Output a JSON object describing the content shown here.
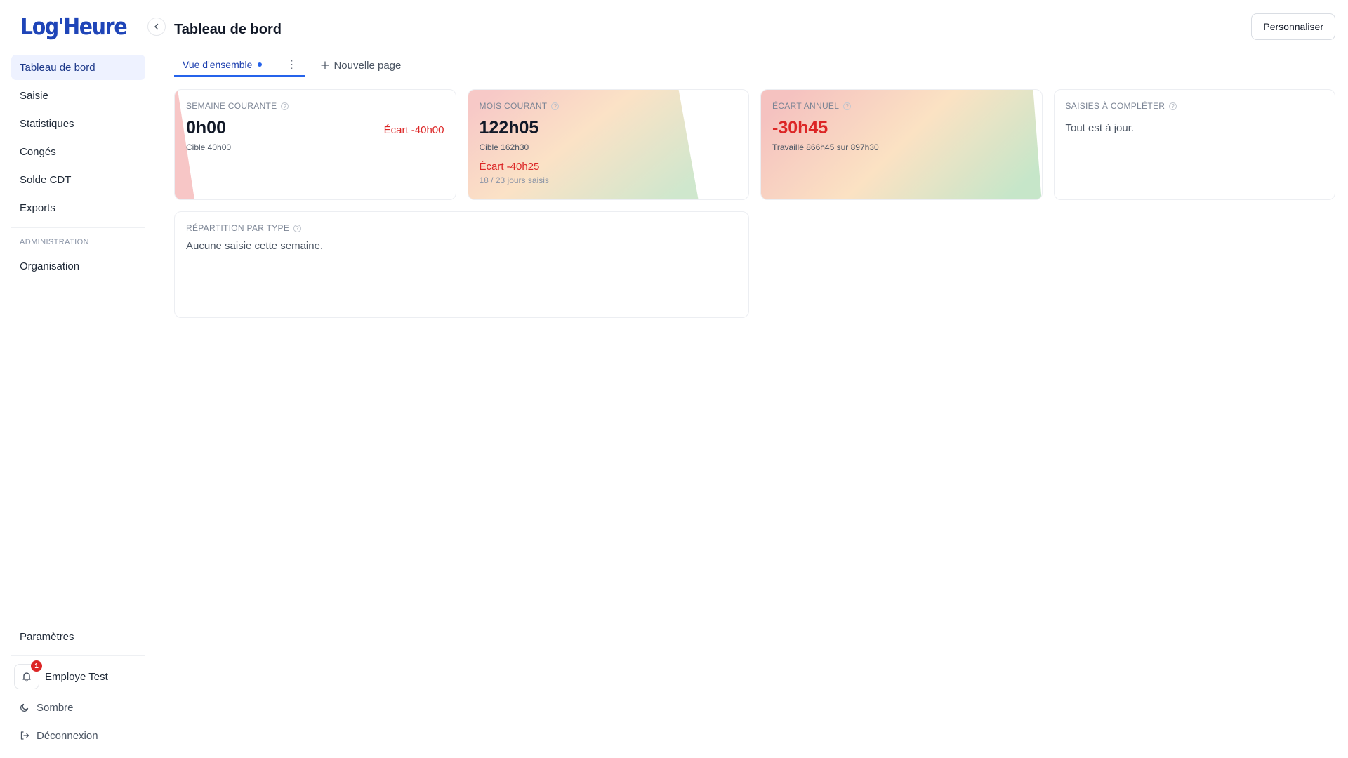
{
  "app": {
    "brand": "Log'Heure"
  },
  "sidebar": {
    "items": [
      {
        "label": "Tableau de bord"
      },
      {
        "label": "Saisie"
      },
      {
        "label": "Statistiques"
      },
      {
        "label": "Congés"
      },
      {
        "label": "Solde CDT"
      },
      {
        "label": "Exports"
      }
    ],
    "section_admin": "ADMINISTRATION",
    "admin_items": [
      {
        "label": "Organisation"
      }
    ],
    "settings_label": "Paramètres",
    "user_name": "Employe Test",
    "notification_count": "1",
    "theme_label": "Sombre",
    "logout_label": "Déconnexion"
  },
  "header": {
    "title": "Tableau de bord",
    "customize_label": "Personnaliser"
  },
  "tabs": {
    "active_label": "Vue d'ensemble",
    "new_page_label": "Nouvelle page"
  },
  "cards": {
    "week": {
      "label": "SEMAINE COURANTE",
      "value": "0h00",
      "ecart": "Écart -40h00",
      "target": "Cible 40h00"
    },
    "month": {
      "label": "MOIS COURANT",
      "value": "122h05",
      "target": "Cible 162h30",
      "ecart": "Écart -40h25",
      "days": "18 / 23 jours saisis"
    },
    "annual": {
      "label": "ÉCART ANNUEL",
      "value": "-30h45",
      "detail": "Travaillé 866h45 sur 897h30"
    },
    "pending": {
      "label": "SAISIES À COMPLÉTER",
      "text": "Tout est à jour."
    },
    "breakdown": {
      "label": "RÉPARTITION PAR TYPE",
      "text": "Aucune saisie cette semaine."
    }
  },
  "colors": {
    "accent": "#2563eb",
    "brand": "#1f45b8",
    "danger": "#dc2626"
  }
}
